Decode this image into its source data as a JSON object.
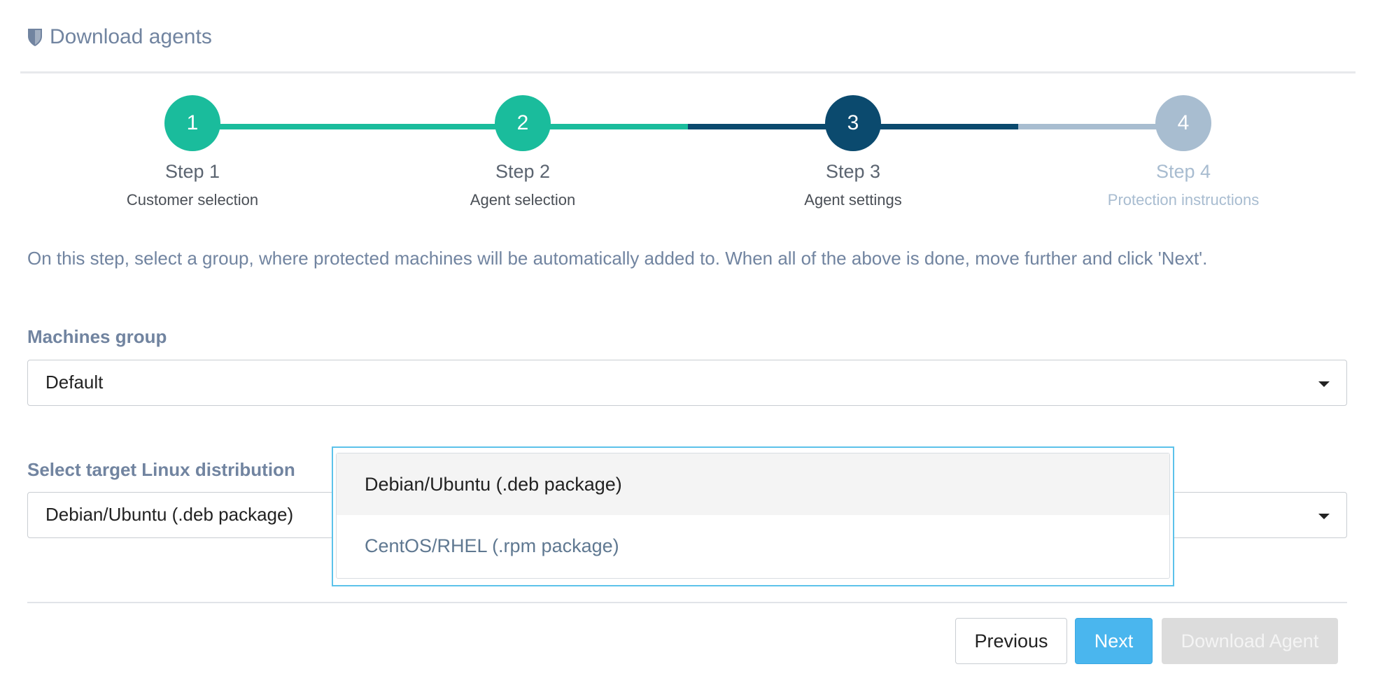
{
  "header": {
    "title": "Download agents",
    "icon": "shield-icon"
  },
  "stepper": {
    "steps": [
      {
        "number": "1",
        "title": "Step 1",
        "subtitle": "Customer selection",
        "state": "done"
      },
      {
        "number": "2",
        "title": "Step 2",
        "subtitle": "Agent selection",
        "state": "done"
      },
      {
        "number": "3",
        "title": "Step 3",
        "subtitle": "Agent settings",
        "state": "active"
      },
      {
        "number": "4",
        "title": "Step 4",
        "subtitle": "Protection instructions",
        "state": "pending"
      }
    ],
    "colors": {
      "done": "#1abc9c",
      "active": "#0b4a6e",
      "pending": "#a8bdd0"
    }
  },
  "description": "On this step, select a group, where protected machines will be automatically added to. When all of the above is done, move further and click 'Next'.",
  "machines_group": {
    "label": "Machines group",
    "value": "Default"
  },
  "linux_distribution": {
    "label": "Select target Linux distribution",
    "value": "Debian/Ubuntu (.deb package)",
    "options": [
      "Debian/Ubuntu (.deb package)",
      "CentOS/RHEL (.rpm package)"
    ]
  },
  "buttons": {
    "previous": "Previous",
    "next": "Next",
    "download": "Download Agent"
  }
}
